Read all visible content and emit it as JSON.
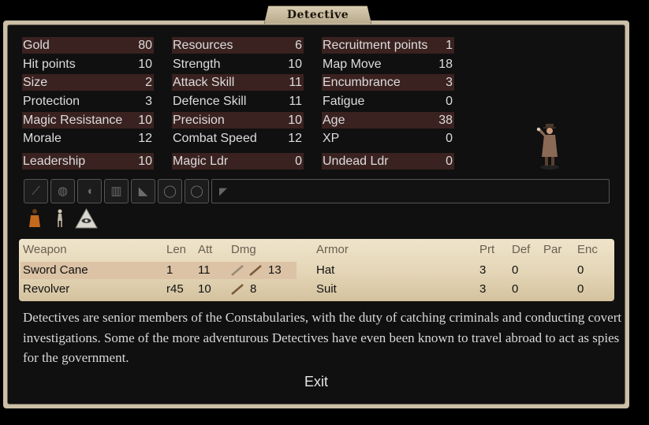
{
  "window": {
    "title": "Detective"
  },
  "stats": {
    "col1": [
      {
        "label": "Gold",
        "value": "80"
      },
      {
        "label": "Hit points",
        "value": "10"
      },
      {
        "label": "Size",
        "value": "2"
      },
      {
        "label": "Protection",
        "value": "3"
      },
      {
        "label": "Magic Resistance",
        "value": "10"
      },
      {
        "label": "Morale",
        "value": "12"
      },
      {
        "label": "Leadership",
        "value": "10"
      }
    ],
    "col2": [
      {
        "label": "Resources",
        "value": "6"
      },
      {
        "label": "Strength",
        "value": "10"
      },
      {
        "label": "Attack Skill",
        "value": "11"
      },
      {
        "label": "Defence Skill",
        "value": "11"
      },
      {
        "label": "Precision",
        "value": "10"
      },
      {
        "label": "Combat Speed",
        "value": "12"
      },
      {
        "label": "Magic Ldr",
        "value": "0"
      }
    ],
    "col3": [
      {
        "label": "Recruitment points",
        "value": "1"
      },
      {
        "label": "Map Move",
        "value": "18"
      },
      {
        "label": "Encumbrance",
        "value": "3"
      },
      {
        "label": "Fatigue",
        "value": "0"
      },
      {
        "label": "Age",
        "value": "38"
      },
      {
        "label": "XP",
        "value": "0"
      },
      {
        "label": "Undead Ldr",
        "value": "0"
      }
    ]
  },
  "equipment_slots": [
    "weapon-slot-icon",
    "shield-slot-icon",
    "helmet-slot-icon",
    "armor-slot-icon",
    "boots-slot-icon",
    "ring-slot-icon",
    "ring-slot-icon",
    "misc-slot-icon"
  ],
  "badges": [
    "warm-clothing-icon",
    "mounted-figure-icon",
    "all-seeing-eye-icon"
  ],
  "weapons": {
    "headers": {
      "weapon": "Weapon",
      "len": "Len",
      "att": "Att",
      "dmg": "Dmg"
    },
    "rows": [
      {
        "name": "Sword Cane",
        "len": "1",
        "att": "11",
        "dmg": "13"
      },
      {
        "name": "Revolver",
        "len": "r45",
        "att": "10",
        "dmg": "8"
      }
    ]
  },
  "armor": {
    "headers": {
      "armor": "Armor",
      "prt": "Prt",
      "def": "Def",
      "par": "Par",
      "enc": "Enc"
    },
    "rows": [
      {
        "name": "Hat",
        "prt": "3",
        "def": "0",
        "par": "",
        "enc": "0"
      },
      {
        "name": "Suit",
        "prt": "3",
        "def": "0",
        "par": "",
        "enc": "0"
      }
    ]
  },
  "description": "Detectives are senior members of the Constabularies, with the duty of catching criminals and conducting covert investigations. Some of the more adventurous Detectives have even been known to travel abroad to act as spies for the government.",
  "buttons": {
    "exit": "Exit"
  },
  "colors": {
    "frame": "#cbbfa6",
    "panel": "#101010",
    "shade_row": "#3a2220",
    "parchment": "#e8dcc0",
    "highlight_row": "#dcc3a6"
  }
}
